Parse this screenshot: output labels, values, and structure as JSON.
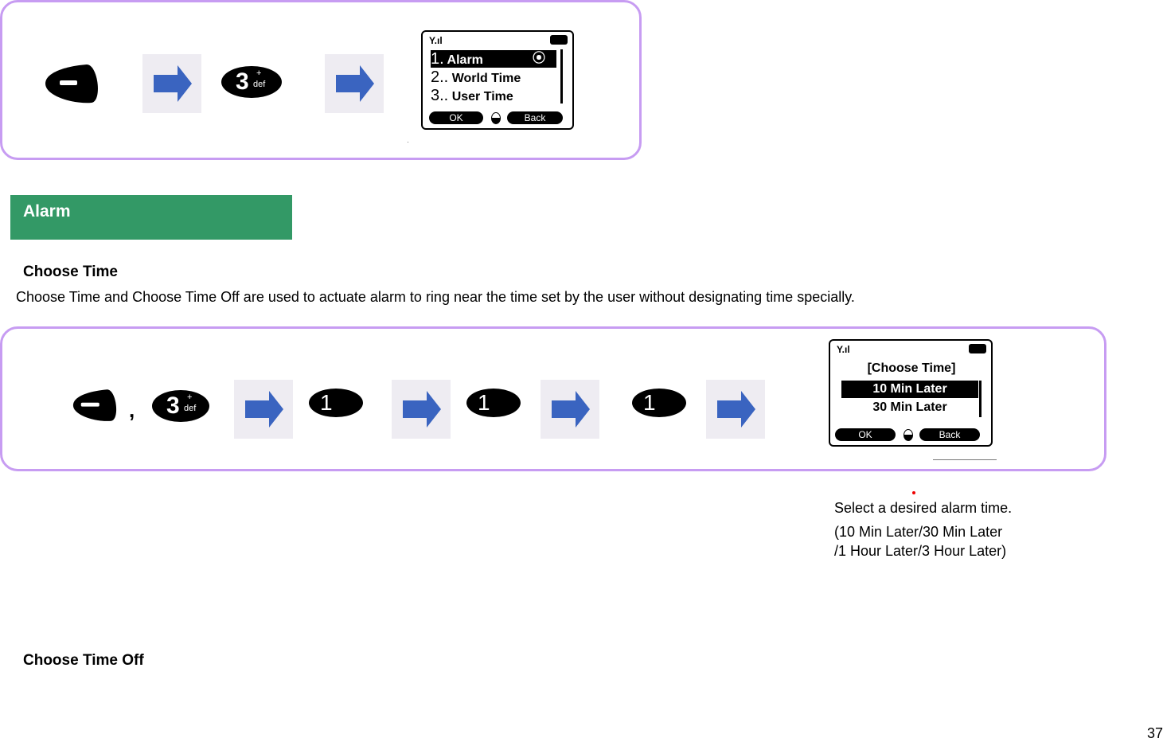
{
  "step1": {
    "keys": [
      "menu-key",
      "arrow",
      "3 def",
      "arrow"
    ],
    "key3": {
      "digit": "3",
      "sub": "def",
      "plus": "+"
    },
    "screen": {
      "signal_icon": "signal-icon",
      "battery_icon": "battery-icon",
      "items": [
        {
          "num": "1.",
          "label": "Alarm",
          "selected": true
        },
        {
          "num": "2..",
          "label": "World Time",
          "selected": false
        },
        {
          "num": "3..",
          "label": "User Time",
          "selected": false
        }
      ],
      "softkeys": {
        "left": "OK",
        "right": "Back"
      }
    }
  },
  "section": {
    "title": "Alarm",
    "color": "#339966"
  },
  "choose_time": {
    "heading": "Choose Time",
    "description": "Choose Time and Choose Time Off are used to actuate alarm to ring near the time set by the user without designating time specially."
  },
  "step2": {
    "comma": ",",
    "key3": {
      "digit": "3",
      "sub": "def",
      "plus": "+"
    },
    "key1": {
      "digit": "1"
    },
    "screen": {
      "title": "[Choose Time]",
      "items": [
        {
          "label": "10 Min Later",
          "selected": true
        },
        {
          "label": "30 Min Later",
          "selected": false
        }
      ],
      "softkeys": {
        "left": "OK",
        "right": "Back"
      }
    },
    "caption": {
      "line1": "Select a desired alarm time.",
      "line2": "(10 Min Later/30 Min Later",
      "line3": "/1 Hour Later/3 Hour Later)"
    }
  },
  "choose_time_off": {
    "heading": "Choose Time Off"
  },
  "page_number": "37",
  "colors": {
    "panel_border": "#c79cf2",
    "arrow": "#3a64c0",
    "arrow_bg": "#eeecf2"
  }
}
